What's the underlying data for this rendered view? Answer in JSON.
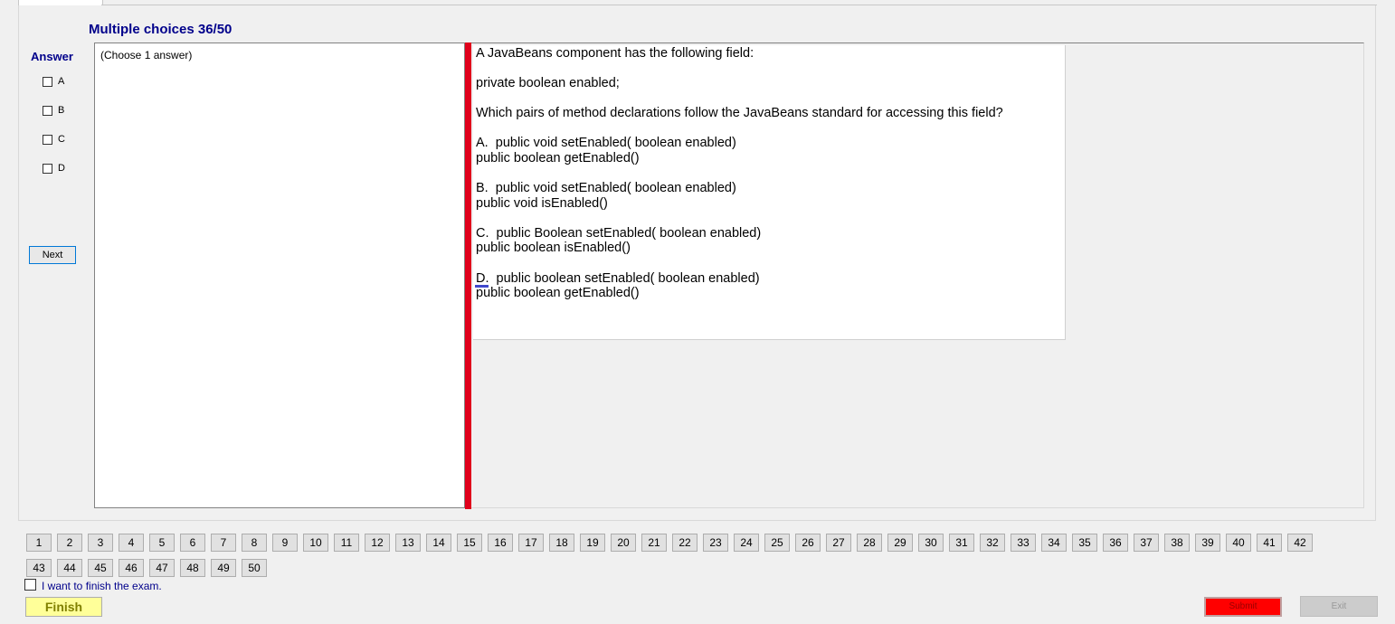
{
  "section_title": "Multiple choices 36/50",
  "answer_panel": {
    "label": "Answer",
    "options": [
      "A",
      "B",
      "C",
      "D"
    ],
    "next_label": "Next"
  },
  "instruction": "(Choose 1 answer)",
  "question_lines": [
    "A JavaBeans component has the following field:",
    "private boolean enabled;",
    "Which pairs of method declarations follow the JavaBeans standard for accessing this field?",
    "A.  public void setEnabled( boolean enabled)",
    "public boolean getEnabled()",
    "B.  public void setEnabled( boolean enabled)",
    "public void isEnabled()",
    "C.  public Boolean setEnabled( boolean enabled)",
    "public boolean isEnabled()",
    "D.  public boolean setEnabled( boolean enabled)",
    "public boolean getEnabled()"
  ],
  "question_numbers": [
    "1",
    "2",
    "3",
    "4",
    "5",
    "6",
    "7",
    "8",
    "9",
    "10",
    "11",
    "12",
    "13",
    "14",
    "15",
    "16",
    "17",
    "18",
    "19",
    "20",
    "21",
    "22",
    "23",
    "24",
    "25",
    "26",
    "27",
    "28",
    "29",
    "30",
    "31",
    "32",
    "33",
    "34",
    "35",
    "36",
    "37",
    "38",
    "39",
    "40",
    "41",
    "42",
    "43",
    "44",
    "45",
    "46",
    "47",
    "48",
    "49",
    "50"
  ],
  "finish_checkbox_label": "I want to finish the exam.",
  "finish_label": "Finish",
  "submit_label": "Submit",
  "exit_label": "Exit"
}
